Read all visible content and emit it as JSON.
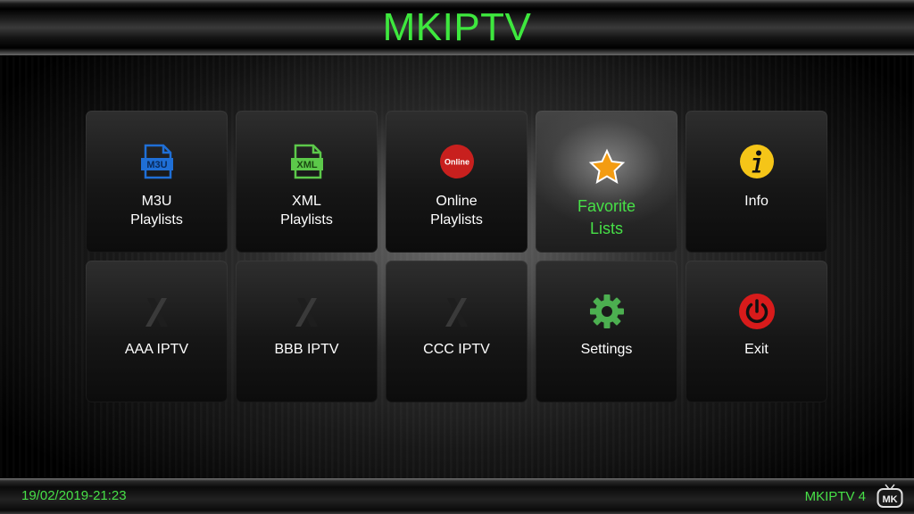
{
  "header": {
    "title": "MKIPTV"
  },
  "tiles": [
    {
      "label1": "M3U",
      "label2": "Playlists",
      "icon": "m3u-file-icon"
    },
    {
      "label1": "XML",
      "label2": "Playlists",
      "icon": "xml-file-icon"
    },
    {
      "label1": "Online",
      "label2": "Playlists",
      "icon": "online-badge-icon",
      "icon_text": "Online"
    },
    {
      "label1": "Favorite",
      "label2": "Lists",
      "icon": "star-icon",
      "selected": true
    },
    {
      "label1": "Info",
      "icon": "info-icon"
    },
    {
      "label1": "AAA IPTV",
      "icon": "x-logo-icon"
    },
    {
      "label1": "BBB IPTV",
      "icon": "x-logo-icon"
    },
    {
      "label1": "CCC IPTV",
      "icon": "x-logo-icon"
    },
    {
      "label1": "Settings",
      "icon": "gear-icon"
    },
    {
      "label1": "Exit",
      "icon": "power-icon"
    }
  ],
  "footer": {
    "datetime": "19/02/2019-21:23",
    "version": "MKIPTV 4",
    "logo_text": "MK"
  },
  "colors": {
    "accent_green": "#3ee83e",
    "m3u_blue": "#1f6fd6",
    "xml_green": "#5cc94a",
    "online_red": "#c8201e",
    "star_orange": "#f39c12",
    "info_yellow": "#f5c518",
    "settings_green": "#4caf50",
    "exit_red": "#d81b1b"
  }
}
